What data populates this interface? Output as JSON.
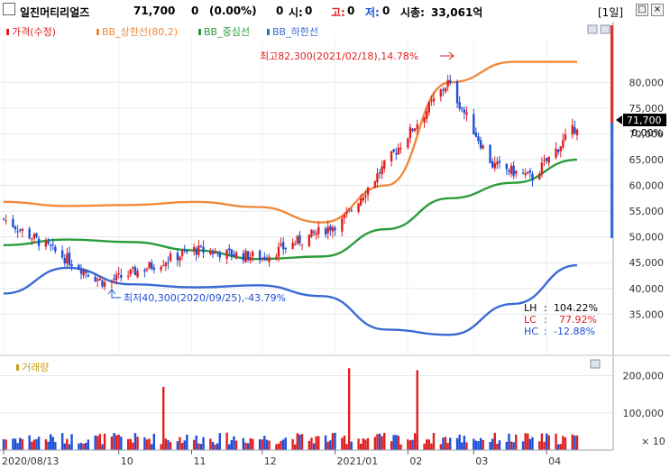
{
  "header": {
    "name": "일진머티리얼즈",
    "price": "71,700",
    "change": "0",
    "change_pct": "(0.00%)",
    "volume": "0",
    "open_label": "시:",
    "open_value": "0",
    "high_label": "고:",
    "high_value": "0",
    "low_label": "저:",
    "low_value": "0",
    "mcap_label": "시총:",
    "mcap_value": "33,061억",
    "period": "[1일]",
    "colors": {
      "high_label": "#e02020",
      "low_label": "#1d4fd8"
    }
  },
  "legend": {
    "price": "가격(수정)",
    "upper": "BB_상한선(80,2)",
    "middle": "BB_중심선",
    "lower": "BB_하한선",
    "volume": "거래량"
  },
  "annotations": {
    "high": "최고82,300(2021/02/18),14.78%",
    "low": "최저40,300(2020/09/25),-43.79%",
    "lh_label": "LH",
    "lh_value": "104.22%",
    "lc_label": "LC",
    "lc_value": "77.92%",
    "hc_label": "HC",
    "hc_value": "-12.88%"
  },
  "price_badge": {
    "value": "71,700",
    "pct": "0.00%"
  },
  "y_axis_unit": "× 10",
  "chart_data": [
    {
      "type": "candlestick",
      "title": "",
      "x_ticks": [
        "2020/08/13",
        "10",
        "11",
        "12",
        "2021/01",
        "02",
        "03",
        "04"
      ],
      "ylim": [
        27000,
        89000
      ],
      "y_ticks": [
        35000,
        40000,
        45000,
        50000,
        55000,
        60000,
        65000,
        70000,
        75000,
        80000
      ],
      "y_tick_labels": [
        "35,000",
        "40,000",
        "45,000",
        "50,000",
        "55,000",
        "60,000",
        "65,000",
        "70,000",
        "75,000",
        "80,000"
      ],
      "key_points": [
        {
          "date": "2020/08/13",
          "close": 53500
        },
        {
          "date": "2020/09/25",
          "close": 41000,
          "low": 40300
        },
        {
          "date": "2020/11/02",
          "close": 47500
        },
        {
          "date": "2020/12/01",
          "close": 46000
        },
        {
          "date": "2021/01/04",
          "close": 53000
        },
        {
          "date": "2021/02/18",
          "close": 80000,
          "high": 82300
        },
        {
          "date": "2021/03/09",
          "close": 64000
        },
        {
          "date": "2021/03/26",
          "close": 61500
        },
        {
          "date": "2021/04/14",
          "close": 71700
        }
      ],
      "series": [
        {
          "name": "BB_상한선(80,2)",
          "values": [
            56800,
            56000,
            56200,
            56800,
            55800,
            52800,
            60000,
            80000,
            84000,
            84000
          ],
          "color": "#f08a3c"
        },
        {
          "name": "BB_중심선",
          "values": [
            48400,
            49500,
            49000,
            47400,
            45700,
            46200,
            51500,
            57500,
            60500,
            65000
          ],
          "color": "#2a9d3a"
        },
        {
          "name": "BB_하한선",
          "values": [
            39000,
            44000,
            40800,
            40200,
            40600,
            38500,
            32000,
            31000,
            37000,
            44500
          ],
          "color": "#3a6ad4"
        }
      ],
      "colors": {
        "up": "#e02020",
        "down": "#1d4fd8"
      }
    },
    {
      "type": "bar",
      "title": "",
      "ylim": [
        0,
        24000
      ],
      "y_ticks": [
        10000,
        20000
      ],
      "y_tick_labels": [
        "100,000",
        "200,000"
      ],
      "peaks": [
        {
          "date": "2020/10/20",
          "value": 17000
        },
        {
          "date": "2021/01/07",
          "value": 22000
        },
        {
          "date": "2021/02/05",
          "value": 21500
        }
      ]
    }
  ]
}
